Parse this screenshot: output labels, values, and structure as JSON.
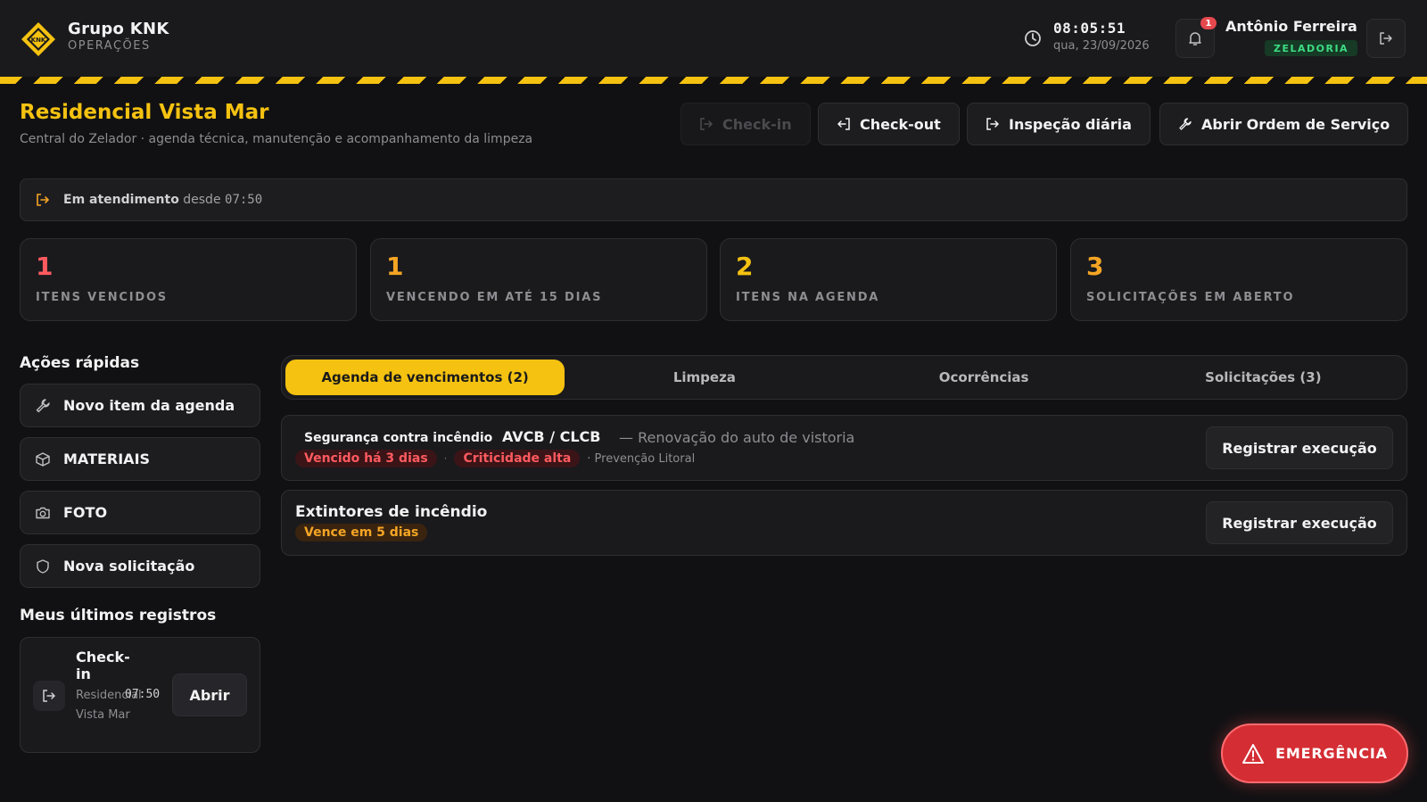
{
  "header": {
    "brand_name": "Grupo KNK",
    "brand_sub": "OPERAÇÕES",
    "logo_text": "KNK",
    "clock_time": "08:05:51",
    "clock_date": "qua, 23/09/2026",
    "notification_count": "1",
    "user_name": "Antônio Ferreira",
    "user_role": "ZELADORIA"
  },
  "page": {
    "title": "Residencial Vista Mar",
    "subtitle": "Central do Zelador · agenda técnica, manutenção e acompanhamento da limpeza",
    "actions": {
      "checkin": "Check-in",
      "checkout": "Check-out",
      "inspection": "Inspeção diária",
      "open_order": "Abrir Ordem de Serviço"
    }
  },
  "status": {
    "label": "Em atendimento",
    "since": "desde",
    "time": "07:50"
  },
  "stats": [
    {
      "value": "1",
      "label": "ITENS VENCIDOS",
      "color": "#ff5a5f"
    },
    {
      "value": "1",
      "label": "VENCENDO EM ATÉ 15 DIAS",
      "color": "#f5a524"
    },
    {
      "value": "2",
      "label": "ITENS NA AGENDA",
      "color": "#f5c211"
    },
    {
      "value": "3",
      "label": "SOLICITAÇÕES EM ABERTO",
      "color": "#f5a524"
    }
  ],
  "quick_actions": {
    "title": "Ações rápidas",
    "items": [
      {
        "label": "Novo item da agenda",
        "icon": "wrench-icon"
      },
      {
        "label": "MATERIAIS",
        "icon": "box-icon"
      },
      {
        "label": "FOTO",
        "icon": "camera-icon"
      },
      {
        "label": "Nova solicitação",
        "icon": "shield-icon"
      }
    ]
  },
  "records": {
    "title": "Meus últimos registros",
    "items": [
      {
        "type": "Check-in",
        "place": "Residencial Vista Mar",
        "time": "07:50",
        "open_label": "Abrir"
      }
    ]
  },
  "tabs": [
    {
      "label": "Agenda de vencimentos (2)",
      "active": true
    },
    {
      "label": "Limpeza",
      "active": false
    },
    {
      "label": "Ocorrências",
      "active": false
    },
    {
      "label": "Solicitações (3)",
      "active": false
    }
  ],
  "agenda": [
    {
      "category": "Segurança contra incêndio",
      "name": "AVCB / CLCB",
      "description": "— Renovação do auto de vistoria",
      "status": "Vencido há 3 dias",
      "criticality": "Criticidade alta",
      "provider": "· Prevenção Litoral",
      "action": "Registrar execução"
    },
    {
      "name": "Extintores de incêndio",
      "status": "Vence em 5 dias",
      "action": "Registrar execução"
    }
  ],
  "emergency": {
    "label": "EMERGÊNCIA"
  },
  "colors": {
    "accent": "#f5c211",
    "danger": "#e5484d",
    "success": "#3ddc84",
    "background": "#111113"
  }
}
